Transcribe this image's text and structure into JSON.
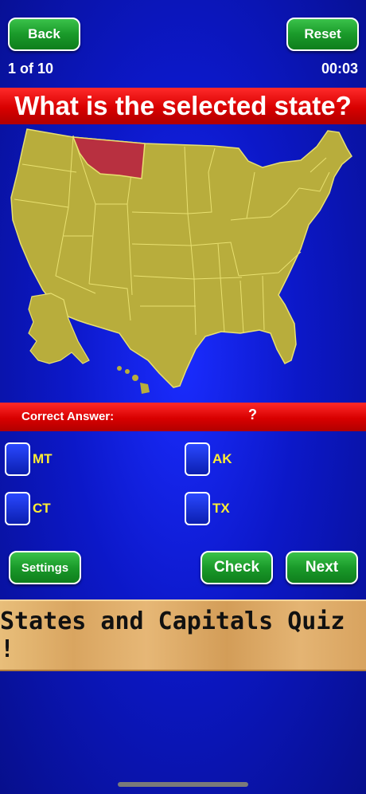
{
  "header": {
    "back_label": "Back",
    "reset_label": "Reset",
    "progress": "1 of 10",
    "timer": "00:03"
  },
  "question": {
    "text": "What is the selected state?"
  },
  "answer": {
    "label": "Correct Answer:",
    "value": "?"
  },
  "choices": [
    {
      "label": "MT"
    },
    {
      "label": "AK"
    },
    {
      "label": "CT"
    },
    {
      "label": "TX"
    }
  ],
  "footer": {
    "settings_label": "Settings",
    "check_label": "Check",
    "next_label": "Next"
  },
  "banner": {
    "text": "States and Capitals Quiz !"
  },
  "colors": {
    "map_fill": "#b8ad3c",
    "map_border": "#e8e070",
    "selected_state": "#b83040",
    "title_red": "#e00000",
    "button_green": "#1a9a2a",
    "choice_text": "#ffee33"
  },
  "map": {
    "selected_state": "Montana"
  }
}
